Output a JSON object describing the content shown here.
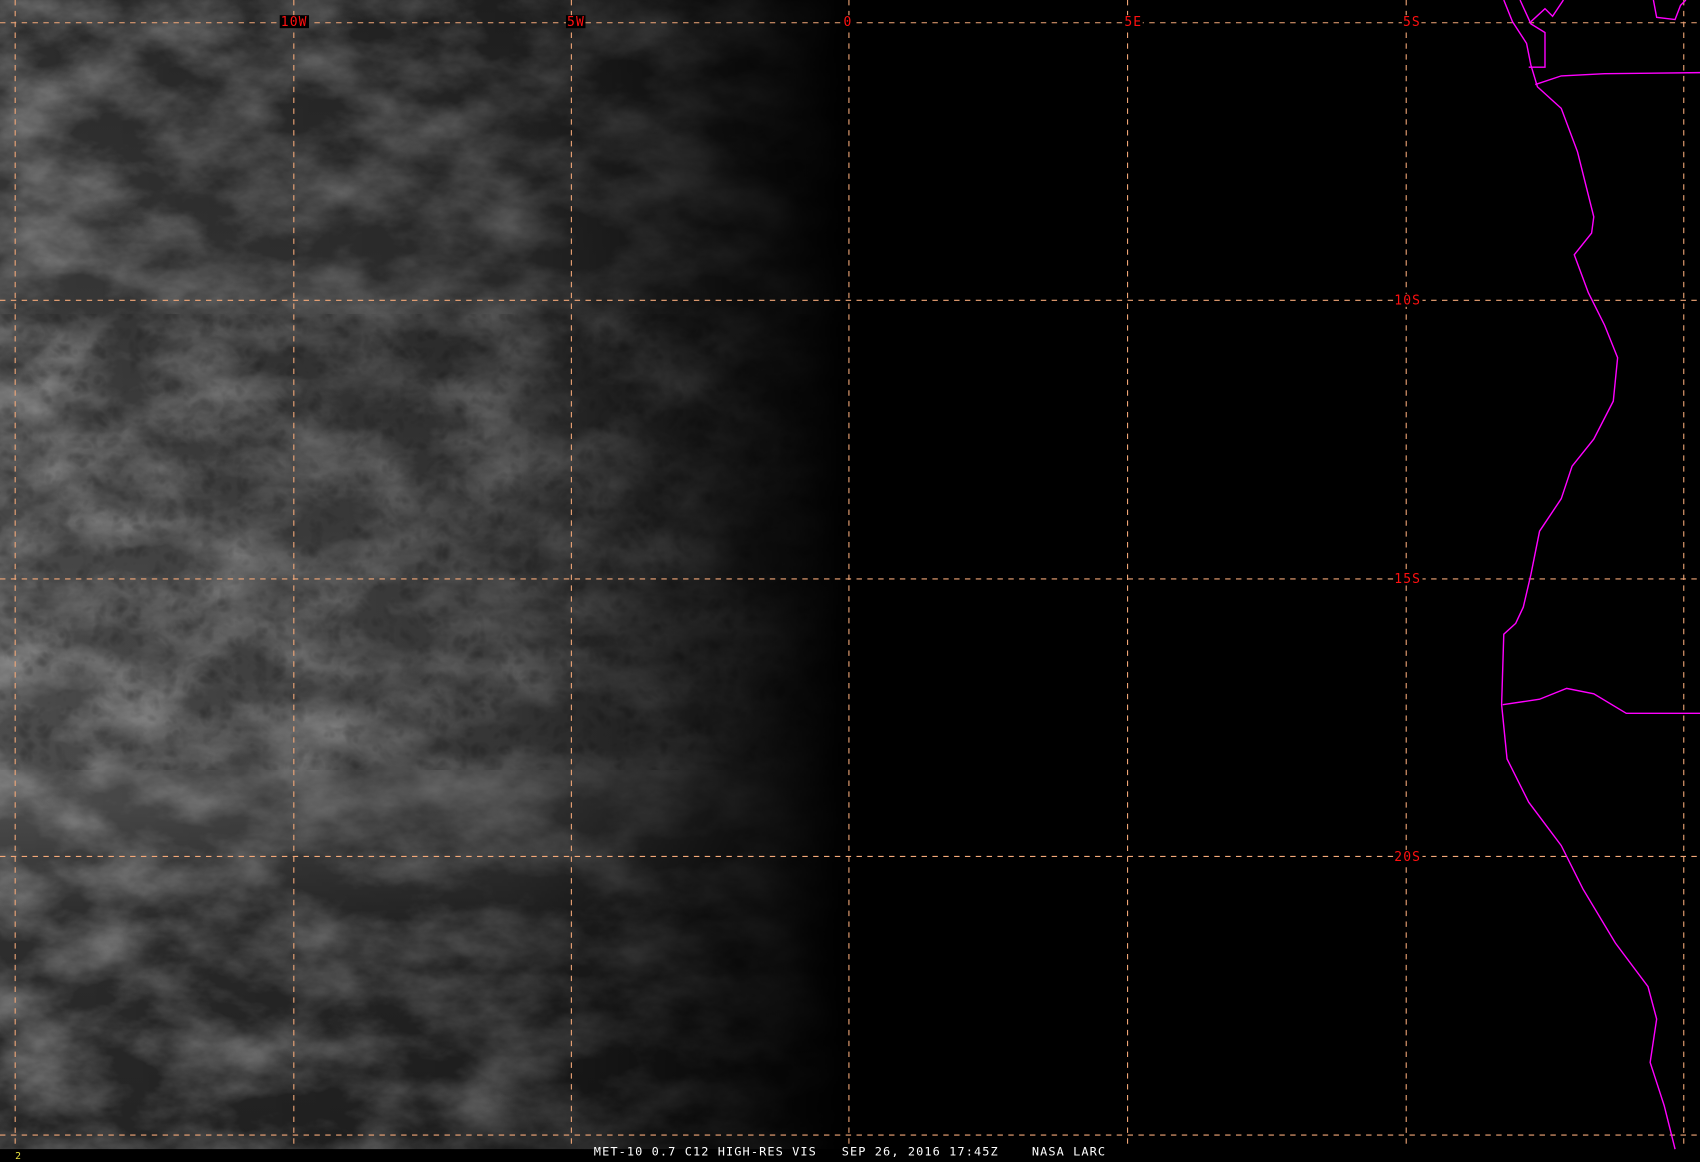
{
  "image": {
    "caption": "MET-10 0.7 C12 HIGH-RES VIS   SEP 26, 2016 17:45Z    NASA LARC",
    "frame_number": "2",
    "colors": {
      "grid": "#f4a878",
      "labels": "#ff1010",
      "coastline": "#ff00ff",
      "frame_number": "#e8e040"
    },
    "longitude_labels": [
      "10W",
      "5W",
      "0",
      "5E",
      "5S"
    ],
    "latitude_labels": [
      "10S",
      "15S",
      "20S"
    ]
  }
}
